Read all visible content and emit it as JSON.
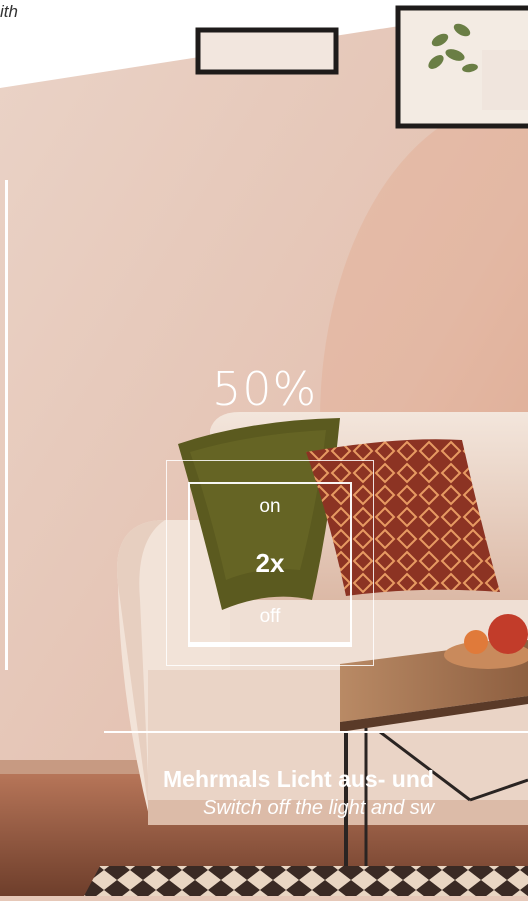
{
  "corner_text": "ith",
  "brightness_label": "50%",
  "switch": {
    "on_label": "on",
    "count_label": "2x",
    "off_label": "off"
  },
  "caption": {
    "german": "Mehrmals Licht aus- und",
    "english": "Switch off the light and sw"
  },
  "colors": {
    "wall": "#e3c2b4",
    "floor": "#7a4a35",
    "sofa": "#efe0d6",
    "green_pillow": "#5a5820",
    "red_pillow": "#8a3222",
    "overlay": "#ffffff"
  }
}
